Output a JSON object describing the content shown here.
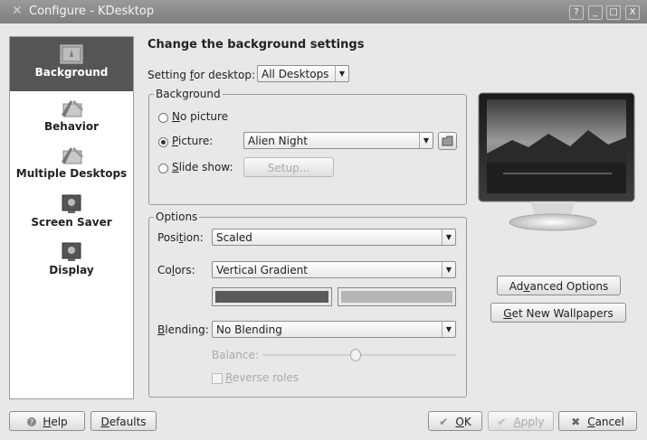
{
  "window": {
    "title": "Configure - KDesktop",
    "controls": [
      "?",
      "_",
      "□",
      "X"
    ]
  },
  "sidebar": {
    "items": [
      {
        "label": "Background",
        "icon": "wallpaper-icon",
        "active": true
      },
      {
        "label": "Behavior",
        "icon": "desktop-tools-icon",
        "active": false
      },
      {
        "label": "Multiple Desktops",
        "icon": "desktop-tools-icon",
        "active": false
      },
      {
        "label": "Screen Saver",
        "icon": "monitor-icon",
        "active": false
      },
      {
        "label": "Display",
        "icon": "monitor-icon",
        "active": false
      }
    ]
  },
  "main": {
    "heading": "Change the background settings",
    "setting_for_desktop": {
      "label_pre": "Setting ",
      "label_mn": "f",
      "label_post": "or desktop:",
      "value": "All Desktops"
    },
    "background_group": {
      "title": "Background",
      "no_picture": {
        "mn": "N",
        "rest": "o picture"
      },
      "picture": {
        "mn": "P",
        "rest": "icture:",
        "value": "Alien Night"
      },
      "slide_show": {
        "mn": "S",
        "rest": "lide show:",
        "setup_label": "Setup..."
      },
      "selected": "picture"
    },
    "options_group": {
      "title": "Options",
      "position": {
        "pre": "Posi",
        "mn": "t",
        "post": "ion:",
        "value": "Scaled"
      },
      "colors": {
        "pre": "Co",
        "mn": "l",
        "post": "ors:",
        "value": "Vertical Gradient",
        "color1": "#5a5a5a",
        "color2": "#b5b5b5"
      },
      "blending": {
        "pre": "",
        "mn": "B",
        "post": "lending:",
        "value": "No Blending"
      },
      "balance_label": "Balance:",
      "reverse_roles": {
        "mn": "R",
        "rest": "everse roles"
      }
    },
    "advanced_options": {
      "pre": "Ad",
      "mn": "v",
      "post": "anced Options"
    },
    "get_new_wallpapers": {
      "pre": "",
      "mn": "G",
      "post": "et New Wallpapers"
    }
  },
  "footer": {
    "help": {
      "mn": "H",
      "rest": "elp"
    },
    "defaults": {
      "mn": "D",
      "rest": "efaults"
    },
    "ok": {
      "mn": "O",
      "rest": "K"
    },
    "apply": {
      "mn": "A",
      "rest": "pply"
    },
    "cancel": {
      "mn": "C",
      "rest": "ancel"
    }
  }
}
